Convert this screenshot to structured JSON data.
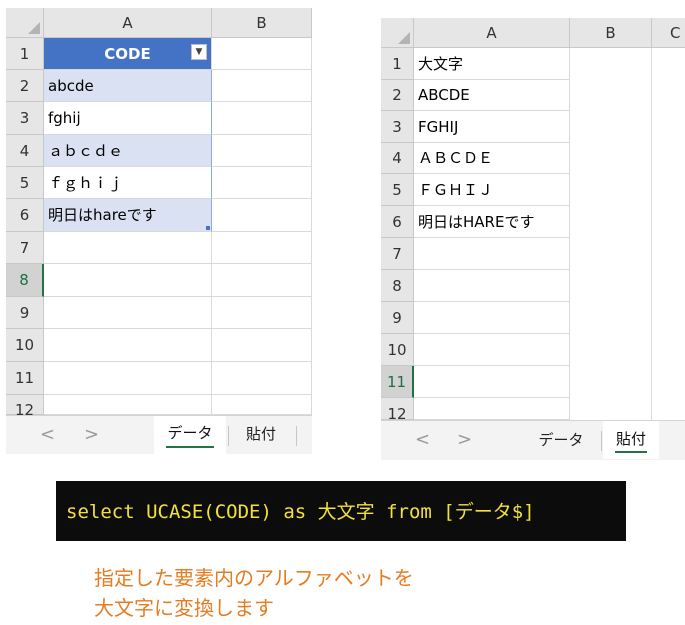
{
  "left_sheet": {
    "columns": [
      "A",
      "B"
    ],
    "row_numbers": [
      "1",
      "2",
      "3",
      "4",
      "5",
      "6",
      "7",
      "8",
      "9",
      "10",
      "11",
      "12"
    ],
    "table_header": "CODE",
    "filter_icon": "▼",
    "cells": [
      "abcde",
      "fghij",
      "ａｂｃｄｅ",
      "ｆｇｈｉｊ",
      "明日はhareです"
    ],
    "tabs": [
      "データ",
      "貼付"
    ],
    "active_tab": "データ",
    "nav_prev": "<",
    "nav_next": ">"
  },
  "right_sheet": {
    "columns": [
      "A",
      "B",
      "C"
    ],
    "row_numbers": [
      "1",
      "2",
      "3",
      "4",
      "5",
      "6",
      "7",
      "8",
      "9",
      "10",
      "11",
      "12"
    ],
    "cells": [
      "大文字",
      "ABCDE",
      "FGHIJ",
      "ＡＢＣＤＥ",
      "ＦＧＨＩＪ",
      "明日はHAREです"
    ],
    "tabs": [
      "データ",
      "貼付"
    ],
    "active_tab": "貼付",
    "nav_prev": "<",
    "nav_next": ">"
  },
  "sql": "select UCASE(CODE) as 大文字 from [データ$]",
  "caption_lines": [
    "指定した要素内のアルファベットを",
    "大文字に変換します"
  ]
}
